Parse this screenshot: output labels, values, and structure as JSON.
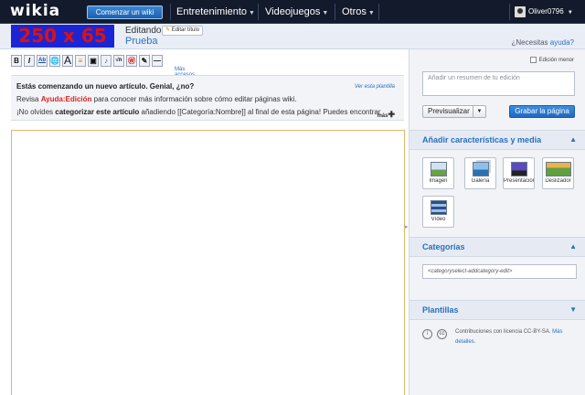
{
  "topbar": {
    "logo": "wikia",
    "start_wiki": "Comenzar un wiki",
    "nav": [
      {
        "label": "Entretenimiento"
      },
      {
        "label": "Videojuegos"
      },
      {
        "label": "Otros"
      }
    ],
    "user": "Oliver0796"
  },
  "header": {
    "ad_text": "250 x 65",
    "editing_label": "Editando",
    "edit_title_btn": "Editar título",
    "page_name": "Prueba",
    "help_prefix": "¿Necesitas",
    "help_link": "ayuda?"
  },
  "toolbar": {
    "buttons": [
      "B",
      "I",
      "Ab",
      "🌐",
      "A",
      "≡",
      "▣",
      "♪",
      "√n",
      "Ⓦ",
      "✎",
      "—",
      "▬"
    ],
    "more_link": "Más accesos directos"
  },
  "notice": {
    "heading": "Estás comenzando un nuevo artículo. Genial, ¿no?",
    "template_link": "Ver esta plantilla",
    "line2_pre": "Revisa ",
    "line2_link": "Ayuda:Edición",
    "line2_post": " para conocer más información sobre cómo editar páginas wiki.",
    "line3_pre": "¡No olvides ",
    "line3_bold": "categorizar este artículo",
    "line3_post": " añadiendo [[Categoría:Nombre]] al final de esta página! Puedes encontrar",
    "more": "más"
  },
  "sidebar": {
    "minor_edit": "Edición menor",
    "summary_placeholder": "Añadir un resumen de tu edición",
    "preview_btn": "Previsualizar",
    "save_btn": "Grabar la página",
    "media_heading": "Añadir características y media",
    "media_items": [
      {
        "label": "Imagen",
        "icon": "image-icon"
      },
      {
        "label": "Galería",
        "icon": "gallery-icon"
      },
      {
        "label": "Presentación",
        "icon": "slideshow-icon"
      },
      {
        "label": "Deslizador",
        "icon": "slider-icon"
      },
      {
        "label": "Vídeo",
        "icon": "video-icon"
      }
    ],
    "categories_heading": "Categorías",
    "category_input": "<categoryselect-addcategory-edit>",
    "templates_heading": "Plantillas",
    "license_text": "Contribuciones con licencia CC-BY-SA.",
    "license_link": "Más detalles."
  }
}
